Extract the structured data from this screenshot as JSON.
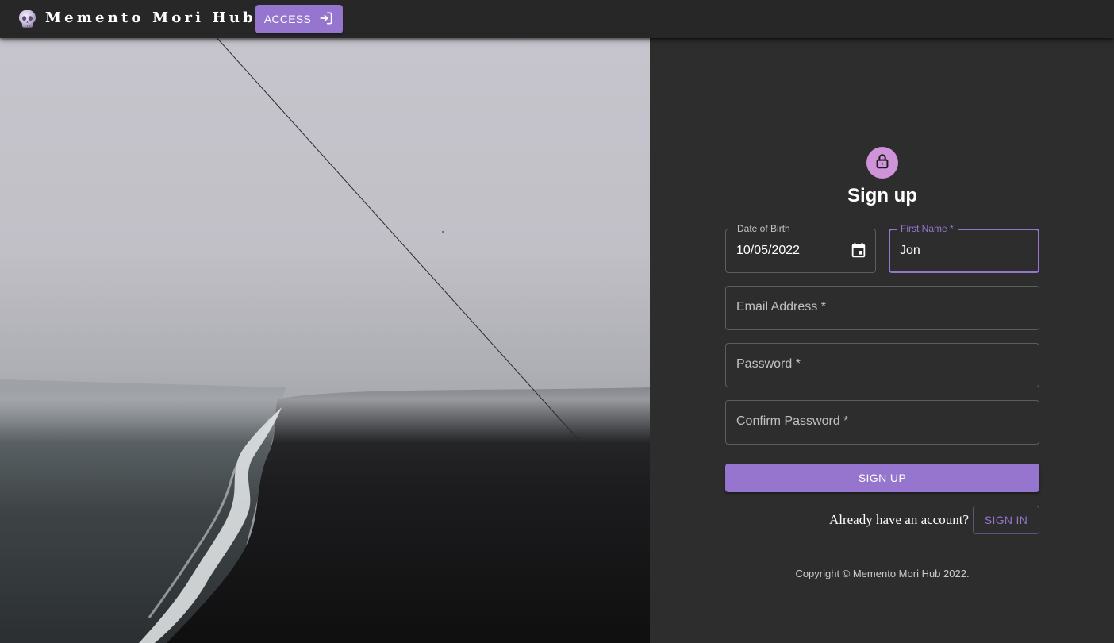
{
  "app": {
    "brand_title": "Memento Mori Hub",
    "access_label": "ACCESS"
  },
  "form": {
    "title": "Sign up",
    "date_of_birth": {
      "label": "Date of Birth",
      "value": "10/05/2022"
    },
    "first_name": {
      "label": "First Name *",
      "value": "Jon"
    },
    "email": {
      "placeholder": "Email Address *"
    },
    "password": {
      "placeholder": "Password *"
    },
    "confirm_password": {
      "placeholder": "Confirm Password *"
    },
    "submit_label": "SIGN UP",
    "already_text": "Already have an account?",
    "signin_label": "SIGN IN",
    "copyright": "Copyright © Memento Mori Hub 2022."
  },
  "colors": {
    "accent": "#9575cd",
    "avatar": "#ce93d8",
    "appbar": "#272727",
    "panel": "#2d2d2d"
  },
  "icons": {
    "brand": "skull-icon",
    "access": "login-icon",
    "avatar": "lock-icon",
    "date": "calendar-icon"
  }
}
